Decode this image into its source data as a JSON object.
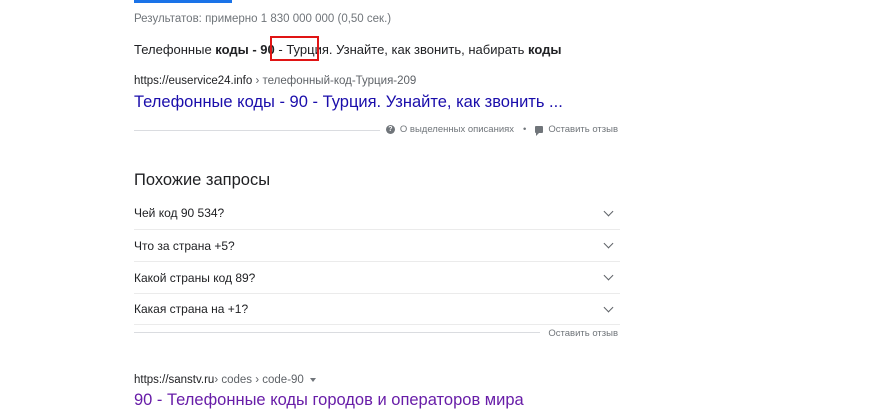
{
  "stats": "Результатов: примерно 1 830 000 000 (0,50 сек.)",
  "featured_snippet": {
    "part1": "Телефонные ",
    "part2_bold": "коды - 90",
    "part3": " - ",
    "part4_highlight": "Турция.",
    "part5": " Узнайте, как звонить, набирать ",
    "part6_bold": "коды"
  },
  "result1": {
    "domain": "https://euservice24.info",
    "path": " › телефонный-код-Турция-209",
    "title": "Телефонные коды - 90 - Турция. Узнайте, как звонить ..."
  },
  "feedback": {
    "about_snippets": "О выделенных описаниях",
    "separator": "•",
    "leave_feedback": "Оставить отзыв"
  },
  "related": {
    "heading": "Похожие запросы",
    "items": [
      {
        "label": "Чей код 90 534?"
      },
      {
        "label": "Что за страна +5?"
      },
      {
        "label": "Какой страны код 89?"
      },
      {
        "label": "Какая страна на +1?"
      }
    ],
    "feedback": "Оставить отзыв"
  },
  "result2": {
    "domain": "https://sanstv.ru",
    "path": " › codes › code-90",
    "title": "90 - Телефонные коды городов и операторов мира"
  },
  "colors": {
    "link": "#1a0dab",
    "visited": "#681da8",
    "highlight_box": "#e01414",
    "accent": "#1a73e8"
  }
}
